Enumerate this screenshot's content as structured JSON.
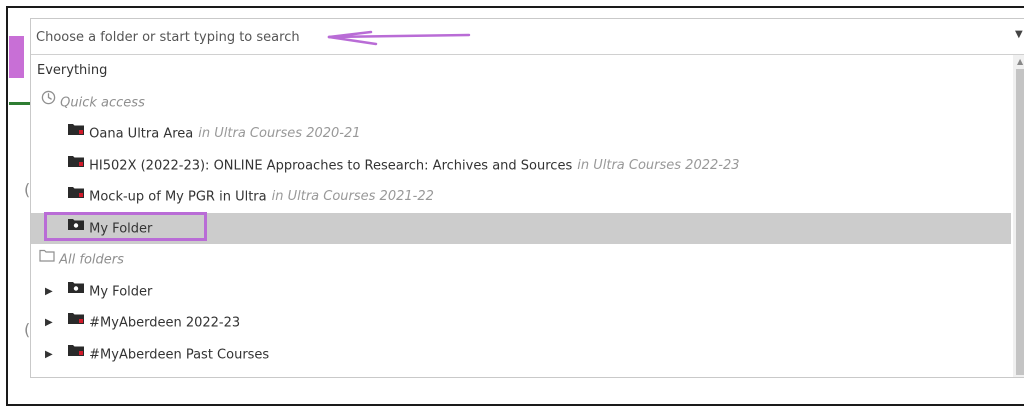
{
  "search": {
    "placeholder": "Choose a folder or start typing to search"
  },
  "icons": {
    "dropdown_caret": "chevron-down-icon",
    "clock": "clock-icon",
    "folder": "folder-icon",
    "folder_outline": "folder-outline-icon",
    "expand": "triangle-right-icon"
  },
  "list": {
    "everything": "Everything",
    "quick_access": {
      "label": "Quick access",
      "items": [
        {
          "label": "Oana Ultra Area",
          "location": "in Ultra Courses 2020-21"
        },
        {
          "label": "HI502X (2022-23): ONLINE Approaches to Research: Archives and Sources",
          "location": "in Ultra Courses 2022-23"
        },
        {
          "label": "Mock-up of My PGR in Ultra",
          "location": "in Ultra Courses 2021-22"
        },
        {
          "label": "My Folder",
          "location": ""
        }
      ]
    },
    "all_folders": {
      "label": "All folders",
      "items": [
        {
          "label": "My Folder"
        },
        {
          "label": "#MyAberdeen 2022-23"
        },
        {
          "label": "#MyAberdeen Past Courses"
        }
      ]
    }
  },
  "colors": {
    "annotation": "#b96cd6",
    "selected_row": "#cccccc",
    "folder_icon": "#2a2a2a",
    "folder_badge": "#d11a2a"
  }
}
